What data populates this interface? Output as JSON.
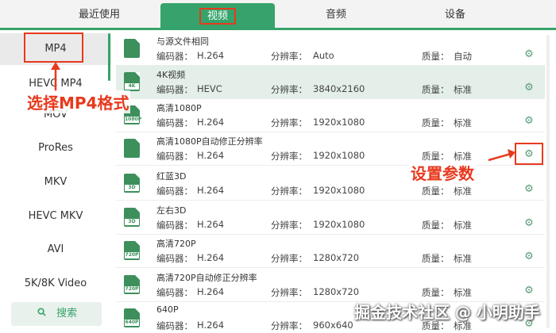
{
  "tabs": [
    {
      "label": "最近使用",
      "active": false
    },
    {
      "label": "视频",
      "active": true
    },
    {
      "label": "音频",
      "active": false
    },
    {
      "label": "设备",
      "active": false
    }
  ],
  "sidebar": {
    "items": [
      "MP4",
      "HEVC MP4",
      "MOV",
      "ProRes",
      "MKV",
      "HEVC MKV",
      "AVI",
      "5K/8K Video"
    ],
    "active": "MP4",
    "search_label": "搜索"
  },
  "labels": {
    "encoder": "编码器：",
    "resolution": "分辨率：",
    "quality": "质量："
  },
  "presets": [
    {
      "title": "与源文件相同",
      "encoder": "H.264",
      "resolution": "Auto",
      "quality": "自动",
      "icon": "copy",
      "tag": ""
    },
    {
      "title": "4K视频",
      "encoder": "HEVC",
      "resolution": "3840x2160",
      "quality": "标准",
      "icon": "video",
      "tag": "4K"
    },
    {
      "title": "高清1080P",
      "encoder": "H.264",
      "resolution": "1920x1080",
      "quality": "标准",
      "icon": "video",
      "tag": "1080P"
    },
    {
      "title": "高清1080P自动修正分辨率",
      "encoder": "H.264",
      "resolution": "1920x1080",
      "quality": "标准",
      "icon": "video",
      "tag": ""
    },
    {
      "title": "红蓝3D",
      "encoder": "H.264",
      "resolution": "1920x1080",
      "quality": "标准",
      "icon": "video",
      "tag": "3D"
    },
    {
      "title": "左右3D",
      "encoder": "H.264",
      "resolution": "1920x1080",
      "quality": "标准",
      "icon": "video",
      "tag": "3D"
    },
    {
      "title": "高清720P",
      "encoder": "H.264",
      "resolution": "1280x720",
      "quality": "标准",
      "icon": "video",
      "tag": "720P"
    },
    {
      "title": "高清720P自动修正分辨率",
      "encoder": "H.264",
      "resolution": "1280x720",
      "quality": "标准",
      "icon": "video",
      "tag": "720P"
    },
    {
      "title": "640P",
      "encoder": "H.264",
      "resolution": "960x640",
      "quality": "标准",
      "icon": "video",
      "tag": "640P"
    }
  ],
  "annotations": {
    "select_mp4": "选择MP4格式",
    "set_params": "设置参数"
  },
  "watermark": "掘金技术社区 @ 小明助手",
  "colors": {
    "accent": "#35a36b",
    "annotation": "#e8391d"
  }
}
